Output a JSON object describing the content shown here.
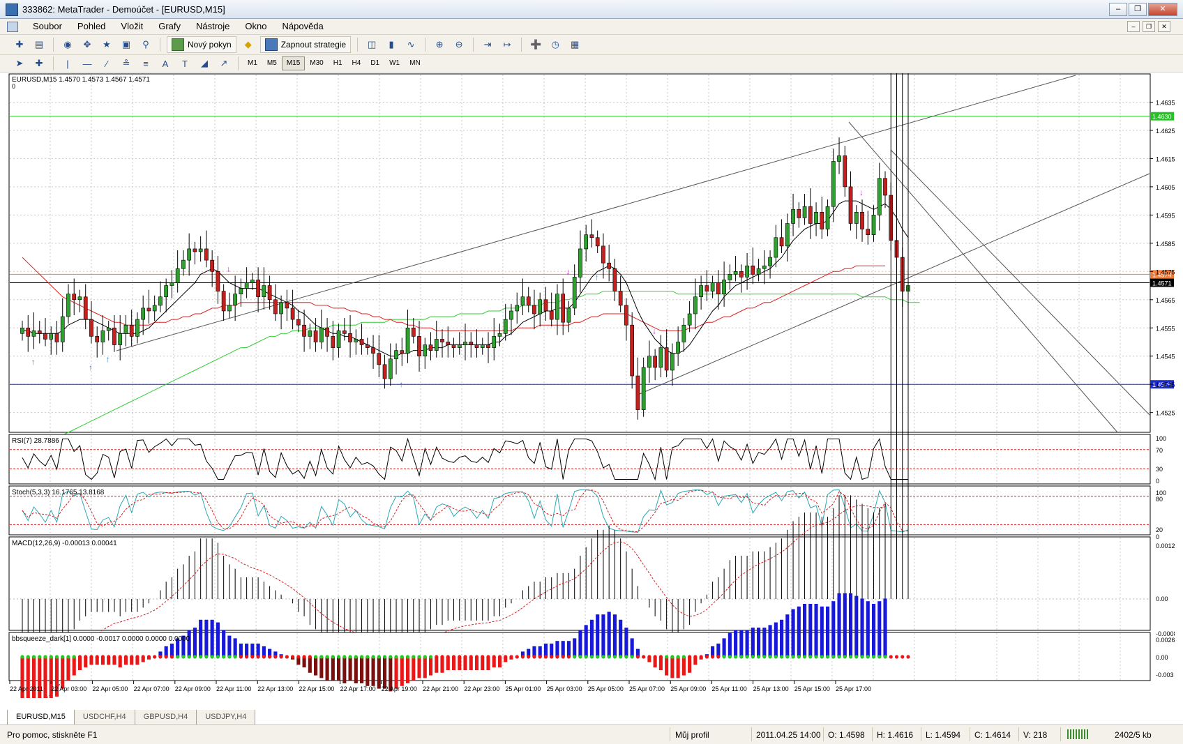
{
  "window": {
    "title": "333862: MetaTrader - Demoúčet - [EURUSD,M15]"
  },
  "menu": [
    "Soubor",
    "Pohled",
    "Vložit",
    "Grafy",
    "Nástroje",
    "Okno",
    "Nápověda"
  ],
  "toolbar": {
    "new_order": "Nový pokyn",
    "strategy": "Zapnout strategie"
  },
  "timeframes": [
    "M1",
    "M5",
    "M15",
    "M30",
    "H1",
    "H4",
    "D1",
    "W1",
    "MN"
  ],
  "active_timeframe": "M15",
  "main_chart": {
    "header": "EURUSD,M15  1.4570 1.4573 1.4567 1.4571",
    "header_sub": "0",
    "price_ticks": [
      "1.4635",
      "1.4625",
      "1.4615",
      "1.4605",
      "1.4595",
      "1.4585",
      "1.4575",
      "1.4565",
      "1.4555",
      "1.4545",
      "1.4535",
      "1.4525"
    ],
    "price_tick_values": [
      1.4635,
      1.4625,
      1.4615,
      1.4605,
      1.4595,
      1.4585,
      1.4575,
      1.4565,
      1.4555,
      1.4545,
      1.4535,
      1.4525
    ],
    "hlines": [
      {
        "label": "1.4630",
        "price": 1.463,
        "color": "#22c322"
      },
      {
        "label": "1.4574",
        "price": 1.4574,
        "color": "#f07a3a"
      },
      {
        "label": "1.4571",
        "price": 1.4571,
        "color": "#000000"
      },
      {
        "label": "1.4535",
        "price": 1.4535,
        "color": "#1a2bd6"
      }
    ]
  },
  "rsi": {
    "label": "RSI(7) 28.7886",
    "levels": [
      "100",
      "70",
      "30",
      "0"
    ]
  },
  "stoch": {
    "label": "Stoch(5,3,3) 16.1765 13.8168",
    "levels": [
      "100",
      "80",
      "20",
      "0"
    ]
  },
  "macd": {
    "label": "MACD(12,26,9) -0.00013 0.00041",
    "levels": [
      "0.0012",
      "0.00",
      "-0.00086"
    ]
  },
  "bbsqueeze": {
    "label": "bbsqueeze_dark[1] 0.0000 -0.0017 0.0000 0.0000 0.0000",
    "levels": [
      "0.0026",
      "0.00",
      "-0.003"
    ]
  },
  "time_axis": [
    "22 Apr 2011",
    "22 Apr 03:00",
    "22 Apr 05:00",
    "22 Apr 07:00",
    "22 Apr 09:00",
    "22 Apr 11:00",
    "22 Apr 13:00",
    "22 Apr 15:00",
    "22 Apr 17:00",
    "22 Apr 19:00",
    "22 Apr 21:00",
    "22 Apr 23:00",
    "25 Apr 01:00",
    "25 Apr 03:00",
    "25 Apr 05:00",
    "25 Apr 07:00",
    "25 Apr 09:00",
    "25 Apr 11:00",
    "25 Apr 13:00",
    "25 Apr 15:00",
    "25 Apr 17:00"
  ],
  "tabs": [
    "EURUSD,M15",
    "USDCHF,H4",
    "GBPUSD,H4",
    "USDJPY,H4"
  ],
  "status": {
    "help": "Pro pomoc, stiskněte F1",
    "profile": "Můj profil",
    "datetime": "2011.04.25 14:00",
    "open": "O: 1.4598",
    "high": "H: 1.4616",
    "low": "L: 1.4594",
    "close": "C: 1.4614",
    "volume": "V: 218",
    "traffic": "2402/5 kb"
  },
  "colors": {
    "bull": "#2ea12e",
    "bear": "#c3201e",
    "grid": "#c8c8c8",
    "ma_fast": "#000000",
    "ma_slow": "#e02020",
    "ma_long": "#33cc33",
    "stoch_main": "#2aa9b5",
    "stoch_signal": "#d82020",
    "squeeze_pos": "#1818d8",
    "squeeze_neg": "#e81818",
    "dot_on": "#22cc22",
    "dot_off": "#e81818"
  },
  "chart_data": {
    "type": "candlestick",
    "close": [
      1.4555,
      1.4552,
      1.4554,
      1.4553,
      1.4551,
      1.4553,
      1.455,
      1.4559,
      1.4567,
      1.4565,
      1.4566,
      1.4558,
      1.4552,
      1.455,
      1.4554,
      1.4555,
      1.4549,
      1.4553,
      1.4556,
      1.4552,
      1.4558,
      1.4562,
      1.4561,
      1.4563,
      1.4566,
      1.457,
      1.4571,
      1.4576,
      1.4579,
      1.4583,
      1.4582,
      1.4583,
      1.4579,
      1.4575,
      1.4568,
      1.4561,
      1.4563,
      1.4567,
      1.4569,
      1.4571,
      1.4572,
      1.4566,
      1.457,
      1.4565,
      1.456,
      1.4564,
      1.4562,
      1.4558,
      1.4556,
      1.4552,
      1.4554,
      1.455,
      1.4555,
      1.4552,
      1.4548,
      1.4554,
      1.4553,
      1.455,
      1.4551,
      1.4549,
      1.4548,
      1.4546,
      1.4542,
      1.4537,
      1.4544,
      1.4547,
      1.4546,
      1.4555,
      1.4552,
      1.4545,
      1.4549,
      1.4547,
      1.4551,
      1.455,
      1.4549,
      1.4548,
      1.4549,
      1.455,
      1.4549,
      1.4548,
      1.4549,
      1.4548,
      1.4552,
      1.4553,
      1.4558,
      1.4561,
      1.4563,
      1.4566,
      1.4563,
      1.456,
      1.4565,
      1.4561,
      1.4558,
      1.4567,
      1.4557,
      1.4562,
      1.4573,
      1.4583,
      1.4588,
      1.4587,
      1.4584,
      1.4578,
      1.4576,
      1.4568,
      1.4563,
      1.4556,
      1.4538,
      1.4526,
      1.4541,
      1.4545,
      1.4541,
      1.4548,
      1.454,
      1.4546,
      1.455,
      1.4556,
      1.456,
      1.4566,
      1.457,
      1.4568,
      1.4571,
      1.4567,
      1.4572,
      1.4574,
      1.4575,
      1.4573,
      1.4577,
      1.4574,
      1.4576,
      1.4577,
      1.458,
      1.4587,
      1.4584,
      1.4592,
      1.4597,
      1.4594,
      1.4598,
      1.4592,
      1.4596,
      1.459,
      1.4598,
      1.4614,
      1.4616,
      1.4605,
      1.4592,
      1.4596,
      1.459,
      1.4588,
      1.4595,
      1.4608,
      1.4602,
      1.4586,
      1.458,
      1.4568,
      1.457
    ],
    "ma_fast": [
      1.4554,
      1.4554,
      1.4553,
      1.4553,
      1.4553,
      1.4553,
      1.4553,
      1.4554,
      1.4556,
      1.4557,
      1.4558,
      1.4558,
      1.4558,
      1.4557,
      1.4556,
      1.4555,
      1.4554,
      1.4553,
      1.4553,
      1.4553,
      1.4553,
      1.4554,
      1.4555,
      1.4557,
      1.4559,
      1.4561,
      1.4563,
      1.4565,
      1.4567,
      1.4569,
      1.4571,
      1.4574,
      1.4575,
      1.4576,
      1.4575,
      1.4573,
      1.4571,
      1.457,
      1.4569,
      1.4569,
      1.4569,
      1.4569,
      1.4568,
      1.4567,
      1.4566,
      1.4565,
      1.4564,
      1.4563,
      1.4561,
      1.456,
      1.4558,
      1.4556,
      1.4555,
      1.4554,
      1.4553,
      1.4553,
      1.4552,
      1.4552,
      1.4551,
      1.455,
      1.4549,
      1.4548,
      1.4547,
      1.4546,
      1.4545,
      1.4545,
      1.4546,
      1.4546,
      1.4547,
      1.4547,
      1.4547,
      1.4548,
      1.4548,
      1.4548,
      1.4549,
      1.4549,
      1.4549,
      1.4549,
      1.4549,
      1.4549,
      1.4549,
      1.4549,
      1.455,
      1.455,
      1.4552,
      1.4553,
      1.4555,
      1.4557,
      1.4558,
      1.4559,
      1.456,
      1.4561,
      1.4561,
      1.4562,
      1.4562,
      1.4562,
      1.4564,
      1.4567,
      1.457,
      1.4573,
      1.4575,
      1.4576,
      1.4577,
      1.4576,
      1.4574,
      1.4571,
      1.4566,
      1.4561,
      1.4557,
      1.4554,
      1.4551,
      1.4549,
      1.4547,
      1.4546,
      1.4546,
      1.4547,
      1.4549,
      1.4552,
      1.4555,
      1.4558,
      1.4561,
      1.4563,
      1.4566,
      1.4568,
      1.457,
      1.4571,
      1.4572,
      1.4573,
      1.4574,
      1.4575,
      1.4576,
      1.4578,
      1.458,
      1.4583,
      1.4586,
      1.4588,
      1.459,
      1.4591,
      1.4592,
      1.4592,
      1.4593,
      1.4596,
      1.4599,
      1.46,
      1.46,
      1.46,
      1.4599,
      1.4598,
      1.4597,
      1.4598,
      1.4599,
      1.4597,
      1.4594,
      1.459,
      1.4587
    ],
    "ma_slow": [
      1.458,
      1.4578,
      1.4576,
      1.4574,
      1.4572,
      1.457,
      1.4568,
      1.4566,
      1.4565,
      1.4564,
      1.4563,
      1.4562,
      1.4561,
      1.456,
      1.4559,
      1.4558,
      1.4557,
      1.4557,
      1.4556,
      1.4556,
      1.4556,
      1.4556,
      1.4556,
      1.4557,
      1.4557,
      1.4557,
      1.4558,
      1.4558,
      1.4559,
      1.4559,
      1.456,
      1.456,
      1.4561,
      1.4562,
      1.4562,
      1.4563,
      1.4563,
      1.4563,
      1.4564,
      1.4564,
      1.4564,
      1.4564,
      1.4564,
      1.4564,
      1.4564,
      1.4564,
      1.4564,
      1.4564,
      1.4564,
      1.4564,
      1.4564,
      1.4563,
      1.4563,
      1.4563,
      1.4562,
      1.4562,
      1.4562,
      1.4561,
      1.4561,
      1.456,
      1.456,
      1.4559,
      1.4559,
      1.4558,
      1.4558,
      1.4557,
      1.4557,
      1.4556,
      1.4556,
      1.4555,
      1.4555,
      1.4555,
      1.4554,
      1.4554,
      1.4554,
      1.4554,
      1.4554,
      1.4554,
      1.4554,
      1.4554,
      1.4554,
      1.4554,
      1.4554,
      1.4554,
      1.4554,
      1.4554,
      1.4555,
      1.4555,
      1.4555,
      1.4555,
      1.4556,
      1.4556,
      1.4556,
      1.4556,
      1.4556,
      1.4556,
      1.4557,
      1.4557,
      1.4558,
      1.4559,
      1.4559,
      1.456,
      1.456,
      1.456,
      1.456,
      1.456,
      1.4559,
      1.4558,
      1.4557,
      1.4556,
      1.4555,
      1.4554,
      1.4554,
      1.4554,
      1.4554,
      1.4554,
      1.4555,
      1.4555,
      1.4556,
      1.4557,
      1.4557,
      1.4558,
      1.4559,
      1.4559,
      1.456,
      1.4561,
      1.4562,
      1.4562,
      1.4563,
      1.4564,
      1.4564,
      1.4565,
      1.4566,
      1.4567,
      1.4568,
      1.4569,
      1.457,
      1.4571,
      1.4572,
      1.4573,
      1.4574,
      1.4575,
      1.4575,
      1.4576,
      1.4576,
      1.4577,
      1.4577,
      1.4577,
      1.4577,
      1.4577,
      1.4577
    ],
    "ma_long": [
      1.451,
      1.4511,
      1.4512,
      1.4513,
      1.4514,
      1.4515,
      1.4516,
      1.4517,
      1.4518,
      1.4519,
      1.452,
      1.4521,
      1.4522,
      1.4523,
      1.4524,
      1.4525,
      1.4526,
      1.4527,
      1.4528,
      1.4529,
      1.453,
      1.4531,
      1.4532,
      1.4533,
      1.4534,
      1.4535,
      1.4536,
      1.4537,
      1.4538,
      1.4539,
      1.454,
      1.4541,
      1.4542,
      1.4543,
      1.4544,
      1.4545,
      1.4546,
      1.4547,
      1.4548,
      1.4548,
      1.4549,
      1.455,
      1.4551,
      1.4552,
      1.4552,
      1.4553,
      1.4553,
      1.4554,
      1.4554,
      1.4554,
      1.4555,
      1.4555,
      1.4555,
      1.4555,
      1.4556,
      1.4556,
      1.4556,
      1.4556,
      1.4556,
      1.4557,
      1.4557,
      1.4557,
      1.4557,
      1.4557,
      1.4558,
      1.4558,
      1.4558,
      1.4558,
      1.4558,
      1.4558,
      1.4558,
      1.4559,
      1.4559,
      1.4559,
      1.4559,
      1.4559,
      1.456,
      1.456,
      1.456,
      1.456,
      1.456,
      1.4561,
      1.4561,
      1.4561,
      1.4562,
      1.4562,
      1.4562,
      1.4563,
      1.4563,
      1.4563,
      1.4563,
      1.4564,
      1.4564,
      1.4564,
      1.4565,
      1.4565,
      1.4566,
      1.4566,
      1.4567,
      1.4567,
      1.4567,
      1.4568,
      1.4568,
      1.4568,
      1.4568,
      1.4568,
      1.4568,
      1.4568,
      1.4568,
      1.4568,
      1.4568,
      1.4568,
      1.4568,
      1.4568,
      1.4567,
      1.4567,
      1.4567,
      1.4567,
      1.4567,
      1.4567,
      1.4567,
      1.4567,
      1.4567,
      1.4567,
      1.4567,
      1.4567,
      1.4567,
      1.4567,
      1.4567,
      1.4567,
      1.4567,
      1.4567,
      1.4567,
      1.4567,
      1.4567,
      1.4567,
      1.4567,
      1.4567,
      1.4567,
      1.4567,
      1.4567,
      1.4567,
      1.4567,
      1.4567,
      1.4567,
      1.4567,
      1.4566,
      1.4566,
      1.4566,
      1.4566,
      1.4566,
      1.4565,
      1.4565,
      1.4565,
      1.4564,
      1.4564,
      1.4564
    ]
  }
}
